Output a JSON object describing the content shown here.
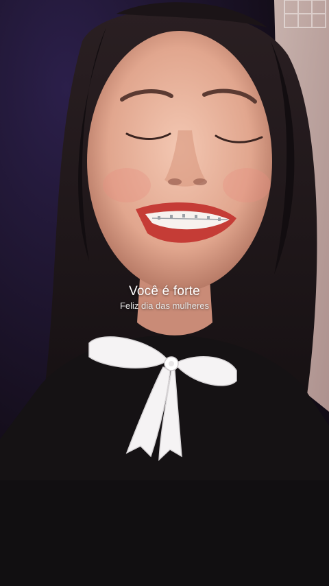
{
  "caption": {
    "main": "Você é forte",
    "sub": "Feliz dia das mulheres"
  }
}
